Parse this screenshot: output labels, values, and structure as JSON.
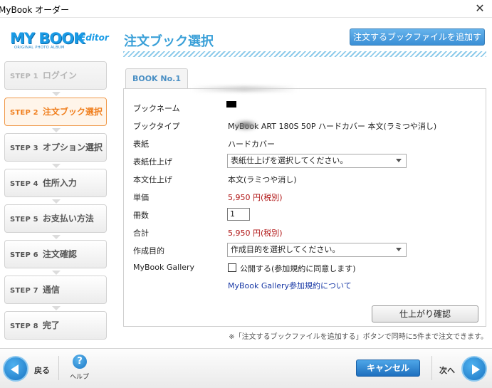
{
  "window": {
    "title": "MyBook オーダー",
    "close_glyph": "✕"
  },
  "logo": {
    "main": "MY BOOK",
    "editor": "Editor",
    "sub": "ORIGINAL PHOTO ALBUM"
  },
  "header": {
    "title": "注文ブック選択",
    "add_file_button": "注文するブックファイルを追加する"
  },
  "steps": [
    {
      "num": "STEP 1",
      "label": "ログイン"
    },
    {
      "num": "STEP 2",
      "label": "注文ブック選択"
    },
    {
      "num": "STEP 3",
      "label": "オプション選択"
    },
    {
      "num": "STEP 4",
      "label": "住所入力"
    },
    {
      "num": "STEP 5",
      "label": "お支払い方法"
    },
    {
      "num": "STEP 6",
      "label": "注文確認"
    },
    {
      "num": "STEP 7",
      "label": "通信"
    },
    {
      "num": "STEP 8",
      "label": "完了"
    }
  ],
  "tab": {
    "label": "BOOK No.1"
  },
  "form": {
    "book_name_label": "ブックネーム",
    "book_type_label": "ブックタイプ",
    "book_type_value": "MyBook ART 180S 50P ハードカバー 本文(ラミつや消し)",
    "cover_label": "表紙",
    "cover_value": "ハードカバー",
    "cover_finish_label": "表紙仕上げ",
    "cover_finish_select": "表紙仕上げを選択してください。",
    "body_finish_label": "本文仕上げ",
    "body_finish_value": "本文(ラミつや消し)",
    "unit_price_label": "単価",
    "unit_price_value": "5,950 円(税別)",
    "qty_label": "冊数",
    "qty_value": "1",
    "total_label": "合計",
    "total_value": "5,950 円(税別)",
    "purpose_label": "作成目的",
    "purpose_select": "作成目的を選択してください。",
    "gallery_label": "MyBook Gallery",
    "gallery_checkbox_label": "公開する(参加規約に同意します)",
    "gallery_link": "MyBook Gallery参加規約について",
    "finish_button": "仕上がり確認"
  },
  "note": "※「注文するブックファイルを追加する」ボタンで同時に5件まで注文できます。",
  "footer": {
    "back": "戻る",
    "help_glyph": "?",
    "help": "ヘルプ",
    "cancel": "キャンセル",
    "next": "次へ"
  }
}
